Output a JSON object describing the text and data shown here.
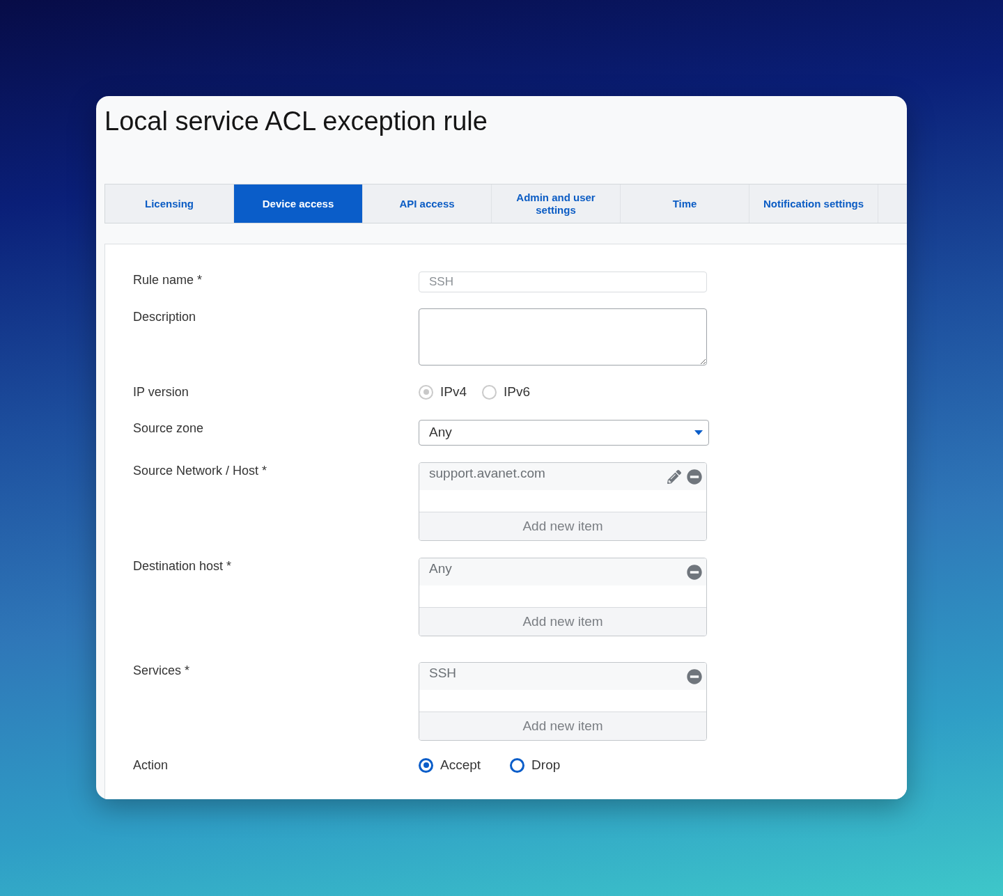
{
  "dialog": {
    "title": "Local service ACL exception rule"
  },
  "tabs": [
    {
      "label": "Licensing",
      "selected": false
    },
    {
      "label": "Device access",
      "selected": true
    },
    {
      "label": "API access",
      "selected": false
    },
    {
      "label": "Admin and user settings",
      "selected": false
    },
    {
      "label": "Time",
      "selected": false
    },
    {
      "label": "Notification settings",
      "selected": false
    }
  ],
  "form": {
    "fields": [
      {
        "kind": "text",
        "label": "Rule name *",
        "value": "SSH",
        "disabled": true
      },
      {
        "kind": "textarea",
        "label": "Description"
      },
      {
        "kind": "radio",
        "label": "IP version",
        "disabled": true,
        "options": [
          {
            "label": "IPv4",
            "selected": true
          },
          {
            "label": "IPv6",
            "selected": false
          }
        ]
      },
      {
        "kind": "select",
        "label": "Source zone",
        "value": "Any"
      },
      {
        "kind": "list",
        "label": "Source Network / Host *",
        "items": [
          {
            "text": "support.avanet.com",
            "editable": true
          }
        ],
        "add_label": "Add new item"
      },
      {
        "kind": "list",
        "label": "Destination host *",
        "items": [
          {
            "text": "Any",
            "editable": false
          }
        ],
        "add_label": "Add new item"
      },
      {
        "kind": "list",
        "label": "Services *",
        "items": [
          {
            "text": "SSH",
            "editable": false
          }
        ],
        "add_label": "Add new item"
      },
      {
        "kind": "radio",
        "label": "Action",
        "disabled": false,
        "options": [
          {
            "label": "Accept",
            "selected": true
          },
          {
            "label": "Drop",
            "selected": false
          }
        ]
      }
    ]
  }
}
